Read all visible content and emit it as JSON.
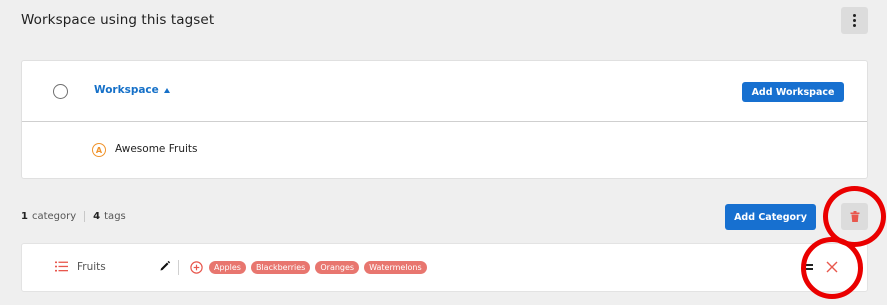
{
  "header": {
    "title": "Workspace using this tagset"
  },
  "workspace_table": {
    "column_label": "Workspace",
    "add_button_label": "Add Workspace",
    "rows": [
      {
        "icon_letter": "A",
        "name": "Awesome Fruits"
      }
    ]
  },
  "summary": {
    "category_count": "1",
    "category_label": "category",
    "tag_count": "4",
    "tag_label": "tags"
  },
  "actions": {
    "add_category_label": "Add Category"
  },
  "category": {
    "name": "Fruits",
    "tags": [
      "Apples",
      "Blackberries",
      "Oranges",
      "Watermelons"
    ]
  },
  "colors": {
    "accent_blue": "#1770d0",
    "tag_red": "#e8766f",
    "workspace_icon_orange": "#f0932b",
    "highlight_ring": "#ea0000"
  },
  "icons": {
    "menu": "kebab-icon",
    "delete": "trash-icon",
    "category": "list-icon",
    "edit": "pencil-icon",
    "add_tag": "plus-circle-icon",
    "reorder": "drag-handle-icon",
    "remove": "close-icon"
  }
}
